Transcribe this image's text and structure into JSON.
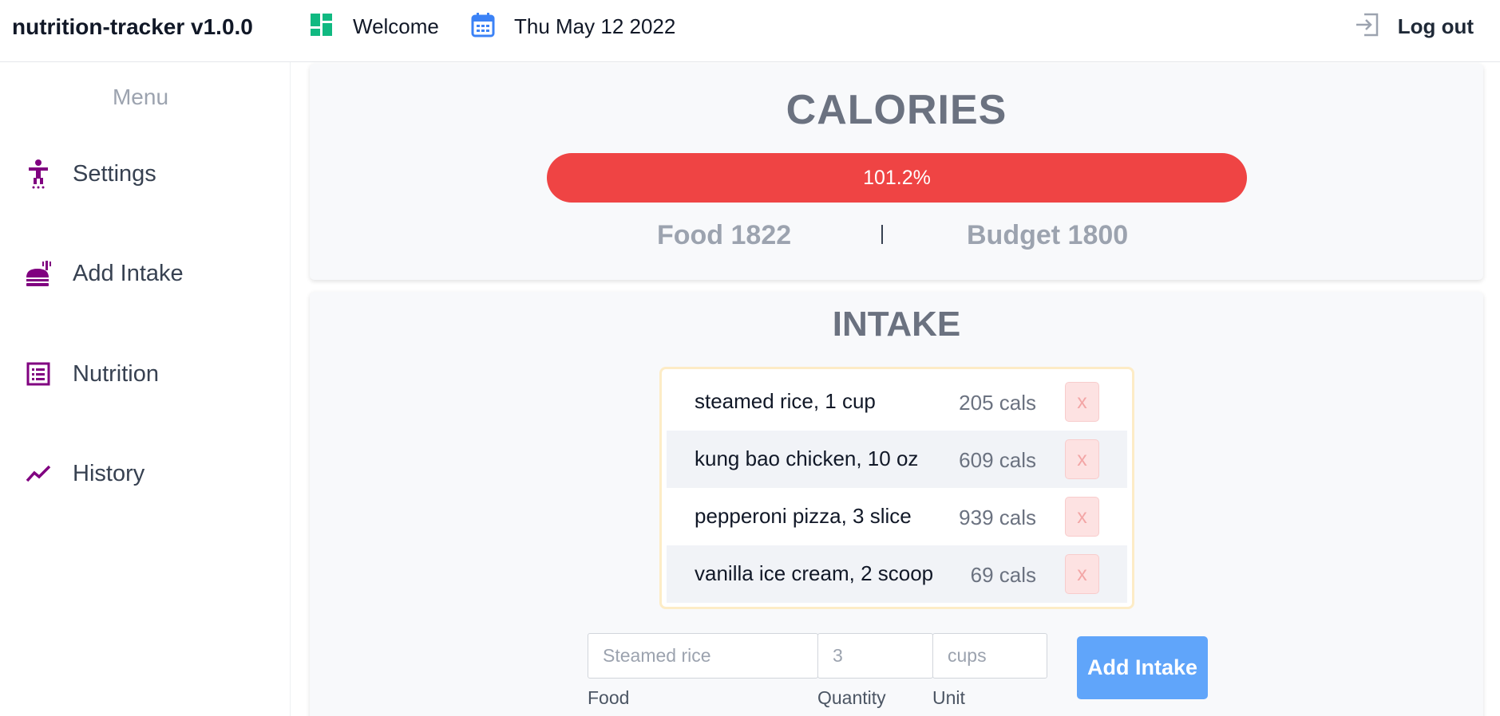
{
  "app": {
    "title": "nutrition-tracker v1.0.0"
  },
  "header": {
    "welcome_label": "Welcome",
    "date_label": "Thu May 12 2022",
    "logout_label": "Log out"
  },
  "sidebar": {
    "menu_title": "Menu",
    "items": [
      {
        "label": "Settings",
        "icon": "accessibility-icon"
      },
      {
        "label": "Add Intake",
        "icon": "food-icon"
      },
      {
        "label": "Nutrition",
        "icon": "list-icon"
      },
      {
        "label": "History",
        "icon": "trend-icon"
      }
    ]
  },
  "calories": {
    "title": "CALORIES",
    "progress_text": "101.2%",
    "progress_fraction": 1.012,
    "food_text": "Food 1822",
    "budget_text": "Budget 1800"
  },
  "intake": {
    "title": "INTAKE",
    "entries": [
      {
        "name": "steamed rice, 1 cup",
        "cals": "205 cals",
        "remove": "x"
      },
      {
        "name": "kung bao chicken, 10 oz",
        "cals": "609 cals",
        "remove": "x"
      },
      {
        "name": "pepperoni pizza, 3 slice",
        "cals": "939 cals",
        "remove": "x"
      },
      {
        "name": "vanilla ice cream, 2 scoop",
        "cals": "69 cals",
        "remove": "x"
      }
    ],
    "form": {
      "food_placeholder": "Steamed rice",
      "quantity_placeholder": "3",
      "unit_placeholder": "cups",
      "food_label": "Food",
      "quantity_label": "Quantity",
      "unit_label": "Unit",
      "submit_label": "Add Intake"
    }
  },
  "colors": {
    "accent_purple": "#800080",
    "progress_red": "#ef4444",
    "button_blue": "#60a5fa",
    "welcome_green": "#10b981",
    "calendar_blue": "#3b82f6"
  }
}
